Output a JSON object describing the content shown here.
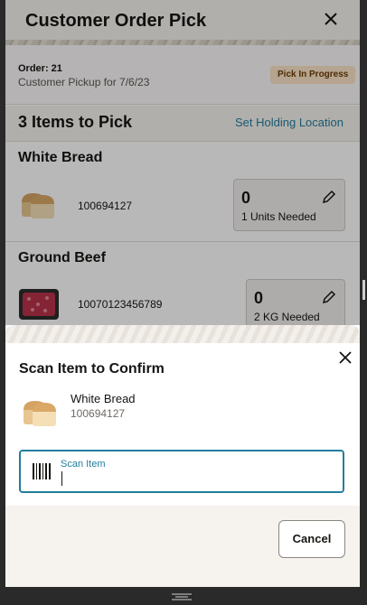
{
  "header": {
    "title": "Customer Order Pick",
    "close_icon": "close-icon"
  },
  "order": {
    "number": "Order: 21",
    "subtitle": "Customer Pickup for 7/6/23",
    "status": "Pick In Progress",
    "status_color": "#fbe3c7"
  },
  "items_bar": {
    "count_label": "3 Items to Pick",
    "holding_link": "Set Holding Location"
  },
  "items": [
    {
      "name": "White Bread",
      "code": "100694127",
      "qty": "0",
      "needed": "1 Units Needed",
      "thumb_icon": "bread-icon"
    },
    {
      "name": "Ground Beef",
      "code": "10070123456789",
      "qty": "0",
      "needed": "2 KG Needed",
      "thumb_icon": "ground-beef-icon"
    }
  ],
  "sheet": {
    "title": "Scan Item to Confirm",
    "item_name": "White Bread",
    "item_code": "100694127",
    "scan_label": "Scan Item",
    "cancel_label": "Cancel"
  },
  "colors": {
    "accent": "#227e9e",
    "text": "#161513"
  }
}
